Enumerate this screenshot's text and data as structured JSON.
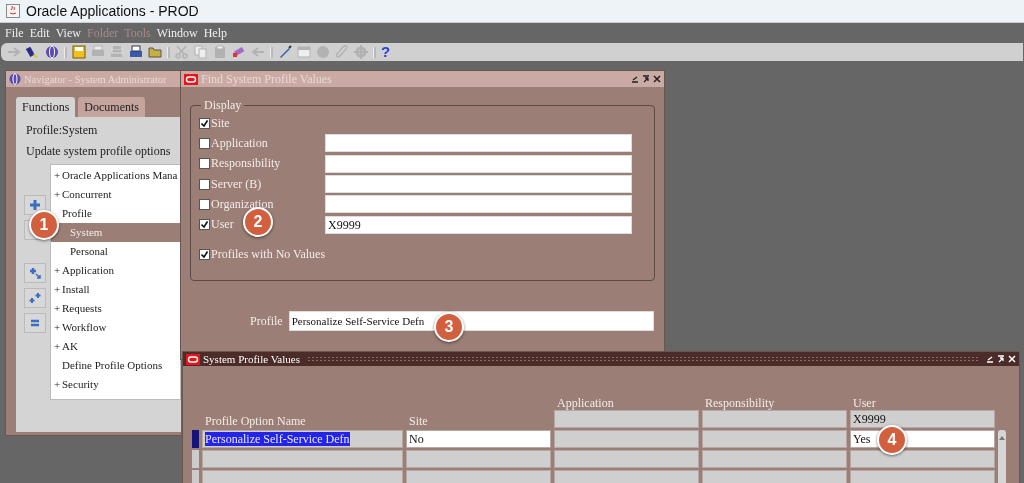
{
  "window": {
    "title": "Oracle Applications - PROD"
  },
  "menu": [
    {
      "label": "File",
      "disabled": false
    },
    {
      "label": "Edit",
      "disabled": false
    },
    {
      "label": "View",
      "disabled": false
    },
    {
      "label": "Folder",
      "disabled": true
    },
    {
      "label": "Tools",
      "disabled": true
    },
    {
      "label": "Window",
      "disabled": false
    },
    {
      "label": "Help",
      "disabled": false
    }
  ],
  "toolbar": [
    {
      "kind": "icon",
      "disabled": true
    },
    {
      "kind": "icon",
      "disabled": false
    },
    {
      "kind": "icon",
      "disabled": false
    },
    {
      "kind": "separator"
    },
    {
      "kind": "icon",
      "disabled": false
    },
    {
      "kind": "icon",
      "disabled": true
    },
    {
      "kind": "icon",
      "disabled": true
    },
    {
      "kind": "icon",
      "disabled": false
    },
    {
      "kind": "icon",
      "disabled": false
    },
    {
      "kind": "separator"
    },
    {
      "kind": "icon",
      "disabled": true
    },
    {
      "kind": "icon",
      "disabled": true
    },
    {
      "kind": "icon",
      "disabled": true
    },
    {
      "kind": "icon",
      "disabled": false
    },
    {
      "kind": "icon",
      "disabled": true
    },
    {
      "kind": "separator"
    },
    {
      "kind": "icon",
      "disabled": false
    },
    {
      "kind": "icon",
      "disabled": true
    },
    {
      "kind": "icon",
      "disabled": true
    },
    {
      "kind": "icon",
      "disabled": true
    },
    {
      "kind": "icon",
      "disabled": true
    },
    {
      "kind": "separator"
    },
    {
      "kind": "text",
      "label": "?",
      "disabled": false
    }
  ],
  "navigator": {
    "title": "Navigator - System Administrator",
    "tabs": [
      {
        "label": "Functions",
        "selected": true
      },
      {
        "label": "Documents",
        "selected": false
      }
    ],
    "heading": "Profile:System",
    "description": "Update system profile options",
    "tree": [
      {
        "label": "Oracle Applications Mana",
        "expander": "+",
        "selected": false
      },
      {
        "label": "Concurrent",
        "expander": "+",
        "selected": false
      },
      {
        "label": "Profile",
        "selected": false,
        "children": [
          {
            "label": "System",
            "selected": true
          },
          {
            "label": "Personal",
            "selected": false
          }
        ]
      },
      {
        "label": "Application",
        "expander": "+",
        "selected": false
      },
      {
        "label": "Install",
        "expander": "+",
        "selected": false
      },
      {
        "label": "Requests",
        "expander": "+",
        "selected": false
      },
      {
        "label": "Workflow",
        "expander": "+",
        "selected": false
      },
      {
        "label": "AK",
        "expander": "+",
        "selected": false
      },
      {
        "label": "Define Profile Options",
        "selected": false
      },
      {
        "label": "Security",
        "expander": "+",
        "selected": false
      }
    ]
  },
  "find_window": {
    "title": "Find System Profile Values",
    "group_label": "Display",
    "options": [
      {
        "kind": "check",
        "label": "Site",
        "checked": true
      },
      {
        "kind": "check-field",
        "label": "Application",
        "checked": false
      },
      {
        "kind": "check-field",
        "label": "Responsibility",
        "checked": false
      },
      {
        "kind": "check-field",
        "label": "Server (B)",
        "checked": false
      },
      {
        "kind": "check-field",
        "label": "Organization",
        "checked": false
      },
      {
        "kind": "check-field",
        "label": "User",
        "checked": true,
        "value": "X9999"
      },
      {
        "kind": "check",
        "label": "Profiles with No Values",
        "checked": true
      }
    ],
    "profile": {
      "label": "Profile",
      "value": "Personalize Self-Service Defn"
    }
  },
  "system_profile_values": {
    "title": "System Profile Values",
    "columns": [
      "Profile Option Name",
      "Site",
      "Application",
      "Responsibility",
      "User"
    ],
    "context": {
      "user": "X9999"
    },
    "rows": [
      {
        "selected": true,
        "profile_option_name": "Personalize Self-Service Defn",
        "site": "No",
        "user": "Yes"
      },
      {
        "selected": false
      },
      {
        "selected": false
      }
    ]
  },
  "callouts": [
    {
      "number": "1"
    },
    {
      "number": "2"
    },
    {
      "number": "3"
    },
    {
      "number": "4"
    }
  ]
}
